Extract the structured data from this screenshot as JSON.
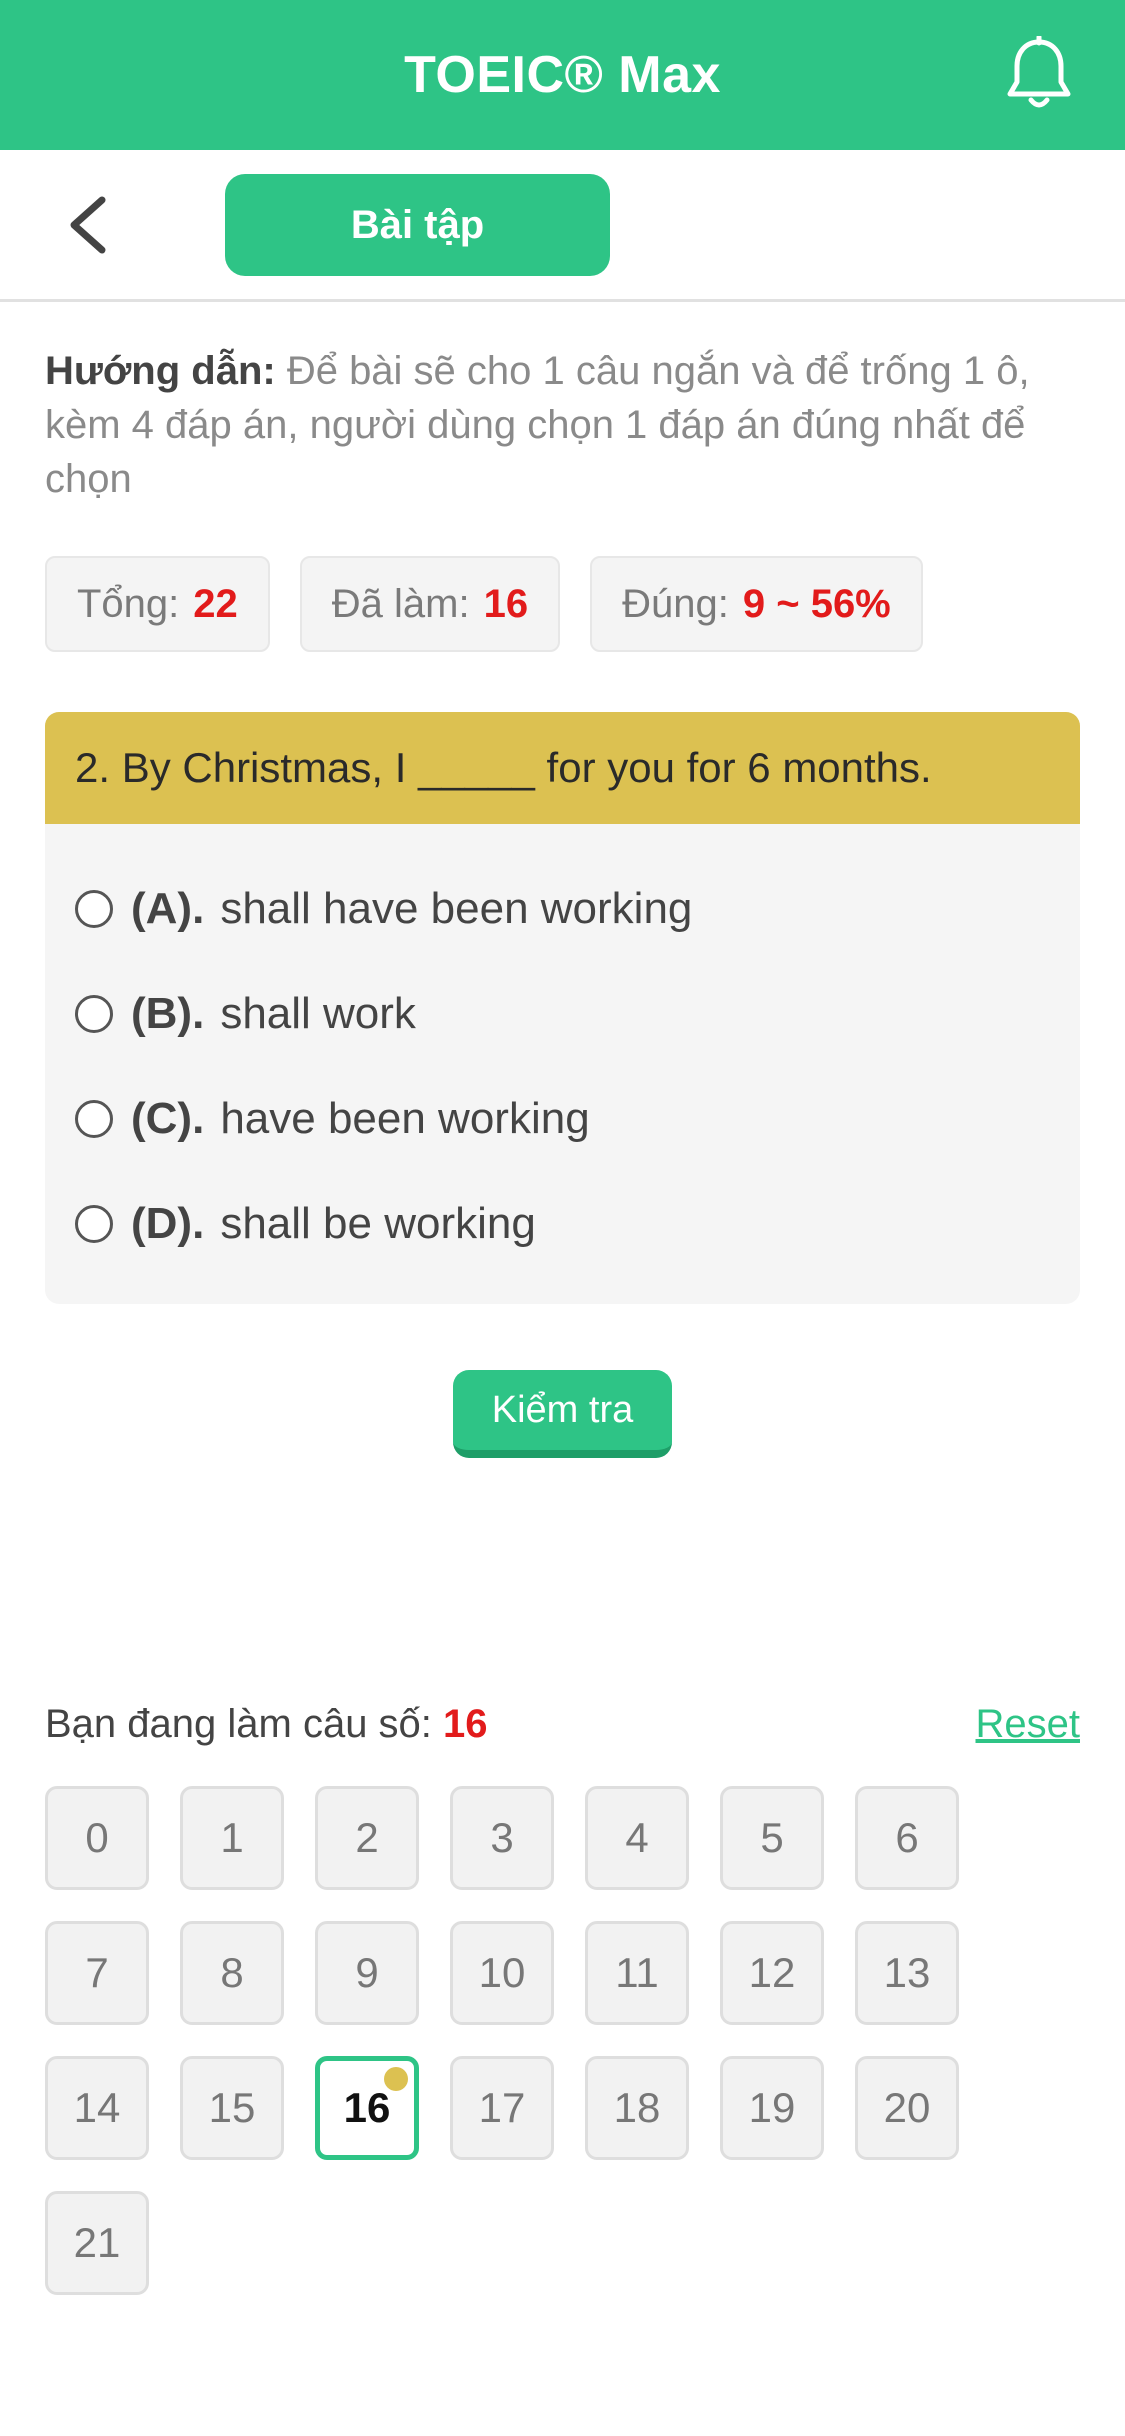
{
  "header": {
    "title": "TOEIC® Max"
  },
  "toolbar": {
    "tab_label": "Bài tập"
  },
  "instructions": {
    "label": "Hướng dẫn:",
    "text": " Để bài sẽ cho 1 câu ngắn và để trống 1 ô, kèm 4 đáp án, người dùng chọn 1 đáp án đúng nhất để chọn"
  },
  "stats": {
    "total_label": "Tổng:",
    "total_value": "22",
    "done_label": "Đã làm:",
    "done_value": "16",
    "correct_label": "Đúng:",
    "correct_value": "9 ~ 56%"
  },
  "question": {
    "text": "2. By Christmas, I _____ for you for 6 months.",
    "options": [
      {
        "letter": "(A).",
        "text": "shall have been working"
      },
      {
        "letter": "(B).",
        "text": "shall work"
      },
      {
        "letter": "(C).",
        "text": "have been working"
      },
      {
        "letter": "(D).",
        "text": "shall be working"
      }
    ]
  },
  "check_button": "Kiểm tra",
  "progress": {
    "label": "Bạn đang làm câu số:",
    "current": "16",
    "reset": "Reset"
  },
  "numbers": [
    "0",
    "1",
    "2",
    "3",
    "4",
    "5",
    "6",
    "7",
    "8",
    "9",
    "10",
    "11",
    "12",
    "13",
    "14",
    "15",
    "16",
    "17",
    "18",
    "19",
    "20",
    "21"
  ],
  "colors": {
    "brand": "#2ec486",
    "question_header": "#dcc151",
    "highlight": "#e21b1b"
  }
}
